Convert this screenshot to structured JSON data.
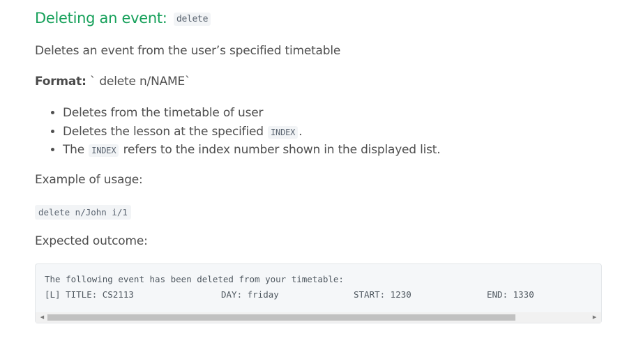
{
  "heading": {
    "text": "Deleting an event: ",
    "command": "delete"
  },
  "description": "Deletes an event from the user’s specified timetable",
  "format": {
    "label": "Format:",
    "value": " ` delete n/NAME`"
  },
  "bullets": [
    {
      "before": "Deletes from the timetable of user",
      "code": "",
      "after": ""
    },
    {
      "before": "Deletes the lesson at the specified ",
      "code": "INDEX",
      "after": "."
    },
    {
      "before": "The ",
      "code": "INDEX",
      "after": " refers to the index number shown in the displayed list."
    }
  ],
  "example_label": "Example of usage:",
  "example_code": "delete n/John i/1",
  "outcome_label": "Expected outcome:",
  "outcome_block": {
    "line1": "The following event has been deleted from your timetable:",
    "line2": {
      "col1": "[L] TITLE: CS2113",
      "col2": "DAY: friday",
      "col3": "START: 1230",
      "col4": "END: 1330"
    }
  },
  "scrollbar": {
    "left_arrow": "◀",
    "right_arrow": "▶",
    "thumb_fraction": 0.83
  }
}
